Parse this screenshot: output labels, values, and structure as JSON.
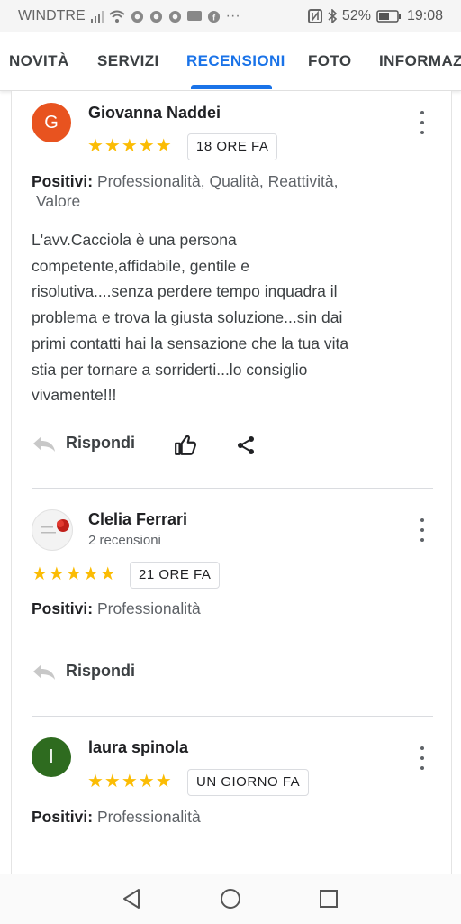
{
  "status_bar": {
    "carrier": "WINDTRE",
    "battery": "52%",
    "time": "19:08"
  },
  "tabs": [
    {
      "label": "NOVITÀ"
    },
    {
      "label": "SERVIZI"
    },
    {
      "label": "RECENSIONI",
      "active": true
    },
    {
      "label": "FOTO"
    },
    {
      "label": "INFORMAZI"
    }
  ],
  "reviews": [
    {
      "author": "Giovanna Naddei",
      "avatar_letter": "G",
      "avatar_color": "#e8531f",
      "rating": 5,
      "stars": "★★★★★",
      "time": "18 ORE FA",
      "positives_label": "Positivi:",
      "positives_line1": "Professionalità, Qualità, Reattività,",
      "positives_line2": "Valore",
      "text": [
        "L'avv.Cacciola è una persona",
        "competente,affidabile, gentile e",
        "risolutiva....senza perdere tempo inquadra il",
        "problema e trova la giusta soluzione...sin dai",
        "primi contatti hai la sensazione che la tua vita",
        "stia per tornare a sorriderti...lo consiglio",
        "vivamente!!!"
      ],
      "reply_label": "Rispondi"
    },
    {
      "author": "Clelia Ferrari",
      "reviews_count": "2 recensioni",
      "rating": 5,
      "stars": "★★★★★",
      "time": "21 ORE FA",
      "positives_label": "Positivi:",
      "positives_line1": "Professionalità",
      "reply_label": "Rispondi"
    },
    {
      "author": "laura spinola",
      "avatar_letter": "l",
      "avatar_color": "#2e6b1f",
      "rating": 5,
      "stars": "★★★★★",
      "time": "UN GIORNO FA",
      "positives_label": "Positivi:",
      "positives_line1": "Professionalità"
    }
  ],
  "colors": {
    "accent": "#1a73e8",
    "star": "#fbbc04"
  }
}
